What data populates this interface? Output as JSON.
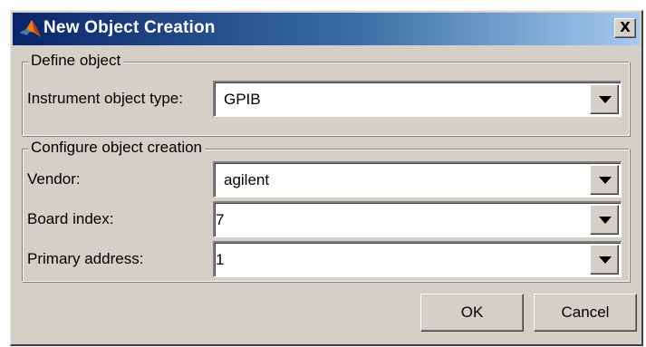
{
  "window": {
    "title": "New Object Creation",
    "app_icon": "matlab-logo-icon",
    "close_icon": "close-icon",
    "close_glyph": "X"
  },
  "define_object": {
    "legend": "Define object",
    "instrument_type": {
      "label": "Instrument object type:",
      "value": "GPIB"
    }
  },
  "configure": {
    "legend": "Configure object creation",
    "vendor": {
      "label": "Vendor:",
      "value": "agilent"
    },
    "board_index": {
      "label": "Board index:",
      "value": "7"
    },
    "primary_address": {
      "label": "Primary address:",
      "value": "1"
    }
  },
  "buttons": {
    "ok": "OK",
    "cancel": "Cancel"
  },
  "colors": {
    "face": "#d4d0c8",
    "title_start": "#0a246a",
    "title_end": "#a6caf0"
  }
}
